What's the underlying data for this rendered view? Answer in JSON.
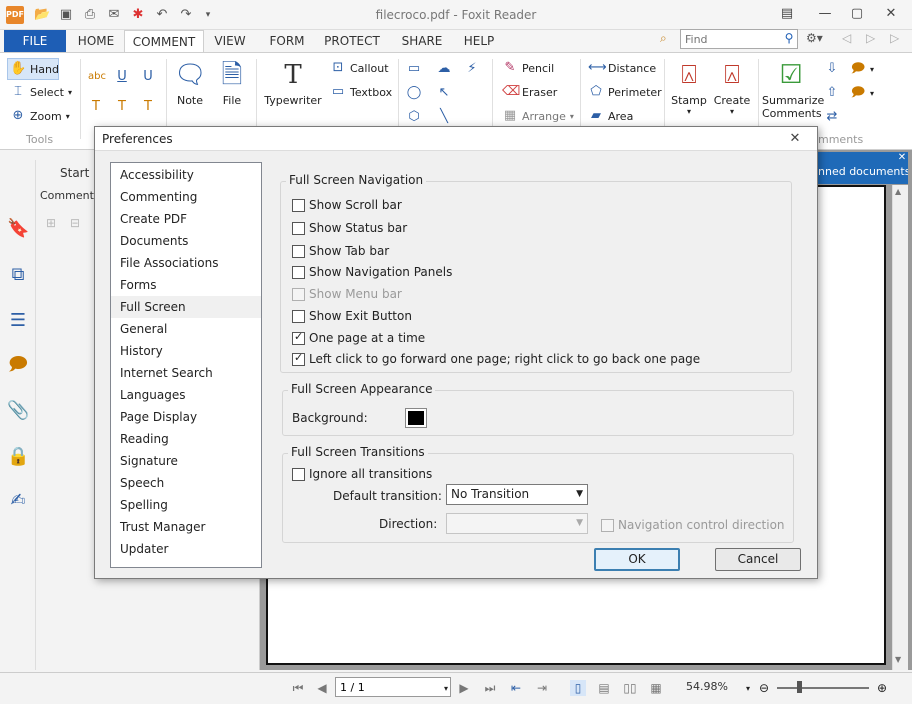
{
  "window": {
    "title": "filecroco.pdf - Foxit Reader",
    "logo_text": "PDF"
  },
  "ribbon_tabs": [
    {
      "label": "FILE"
    },
    {
      "label": "HOME"
    },
    {
      "label": "COMMENT"
    },
    {
      "label": "VIEW"
    },
    {
      "label": "FORM"
    },
    {
      "label": "PROTECT"
    },
    {
      "label": "SHARE"
    },
    {
      "label": "HELP"
    }
  ],
  "find": {
    "placeholder": "Find"
  },
  "ribbon": {
    "hand": "Hand",
    "select": "Select",
    "zoom": "Zoom",
    "tools_group": "Tools",
    "note": "Note",
    "file": "File",
    "typewriter": "Typewriter",
    "callout": "Callout",
    "textbox": "Textbox",
    "pencil": "Pencil",
    "eraser": "Eraser",
    "arrange": "Arrange",
    "distance": "Distance",
    "perimeter": "Perimeter",
    "area": "Area",
    "stamp": "Stamp",
    "create": "Create",
    "summarize_line1": "Summarize",
    "summarize_line2": "Comments",
    "comments_group_partial": "mments"
  },
  "left_panel": {
    "start_tab": "Start",
    "comments_label": "Comments"
  },
  "banner_text": "nned documents",
  "statusbar": {
    "page_value": "1 / 1",
    "zoom": "54.98%"
  },
  "dialog": {
    "title": "Preferences",
    "categories": [
      "Accessibility",
      "Commenting",
      "Create PDF",
      "Documents",
      "File Associations",
      "Forms",
      "Full Screen",
      "General",
      "History",
      "Internet Search",
      "Languages",
      "Page Display",
      "Reading",
      "Signature",
      "Speech",
      "Spelling",
      "Trust Manager",
      "Updater"
    ],
    "selected_category": "Full Screen",
    "navigation": {
      "legend": "Full Screen Navigation",
      "options": [
        {
          "label": "Show Scroll bar",
          "checked": false,
          "enabled": true
        },
        {
          "label": "Show Status bar",
          "checked": false,
          "enabled": true
        },
        {
          "label": "Show Tab bar",
          "checked": false,
          "enabled": true
        },
        {
          "label": "Show Navigation Panels",
          "checked": false,
          "enabled": true
        },
        {
          "label": "Show Menu bar",
          "checked": false,
          "enabled": false
        },
        {
          "label": "Show Exit Button",
          "checked": false,
          "enabled": true
        },
        {
          "label": "One page at a time",
          "checked": true,
          "enabled": true
        },
        {
          "label": "Left click to go forward one page; right click to go back one page",
          "checked": true,
          "enabled": true
        }
      ]
    },
    "appearance": {
      "legend": "Full Screen Appearance",
      "background_label": "Background:",
      "background_color": "#000000"
    },
    "transitions": {
      "legend": "Full Screen Transitions",
      "ignore_label": "Ignore all transitions",
      "ignore_checked": false,
      "default_label": "Default transition:",
      "default_value": "No Transition",
      "direction_label": "Direction:",
      "direction_value": "",
      "nav_control_label": "Navigation control direction",
      "nav_control_checked": false
    },
    "ok": "OK",
    "cancel": "Cancel"
  },
  "colors": {
    "file_tab": "#1e5eb5",
    "accent": "#2d5fa6",
    "banner": "#1f6ab8"
  }
}
